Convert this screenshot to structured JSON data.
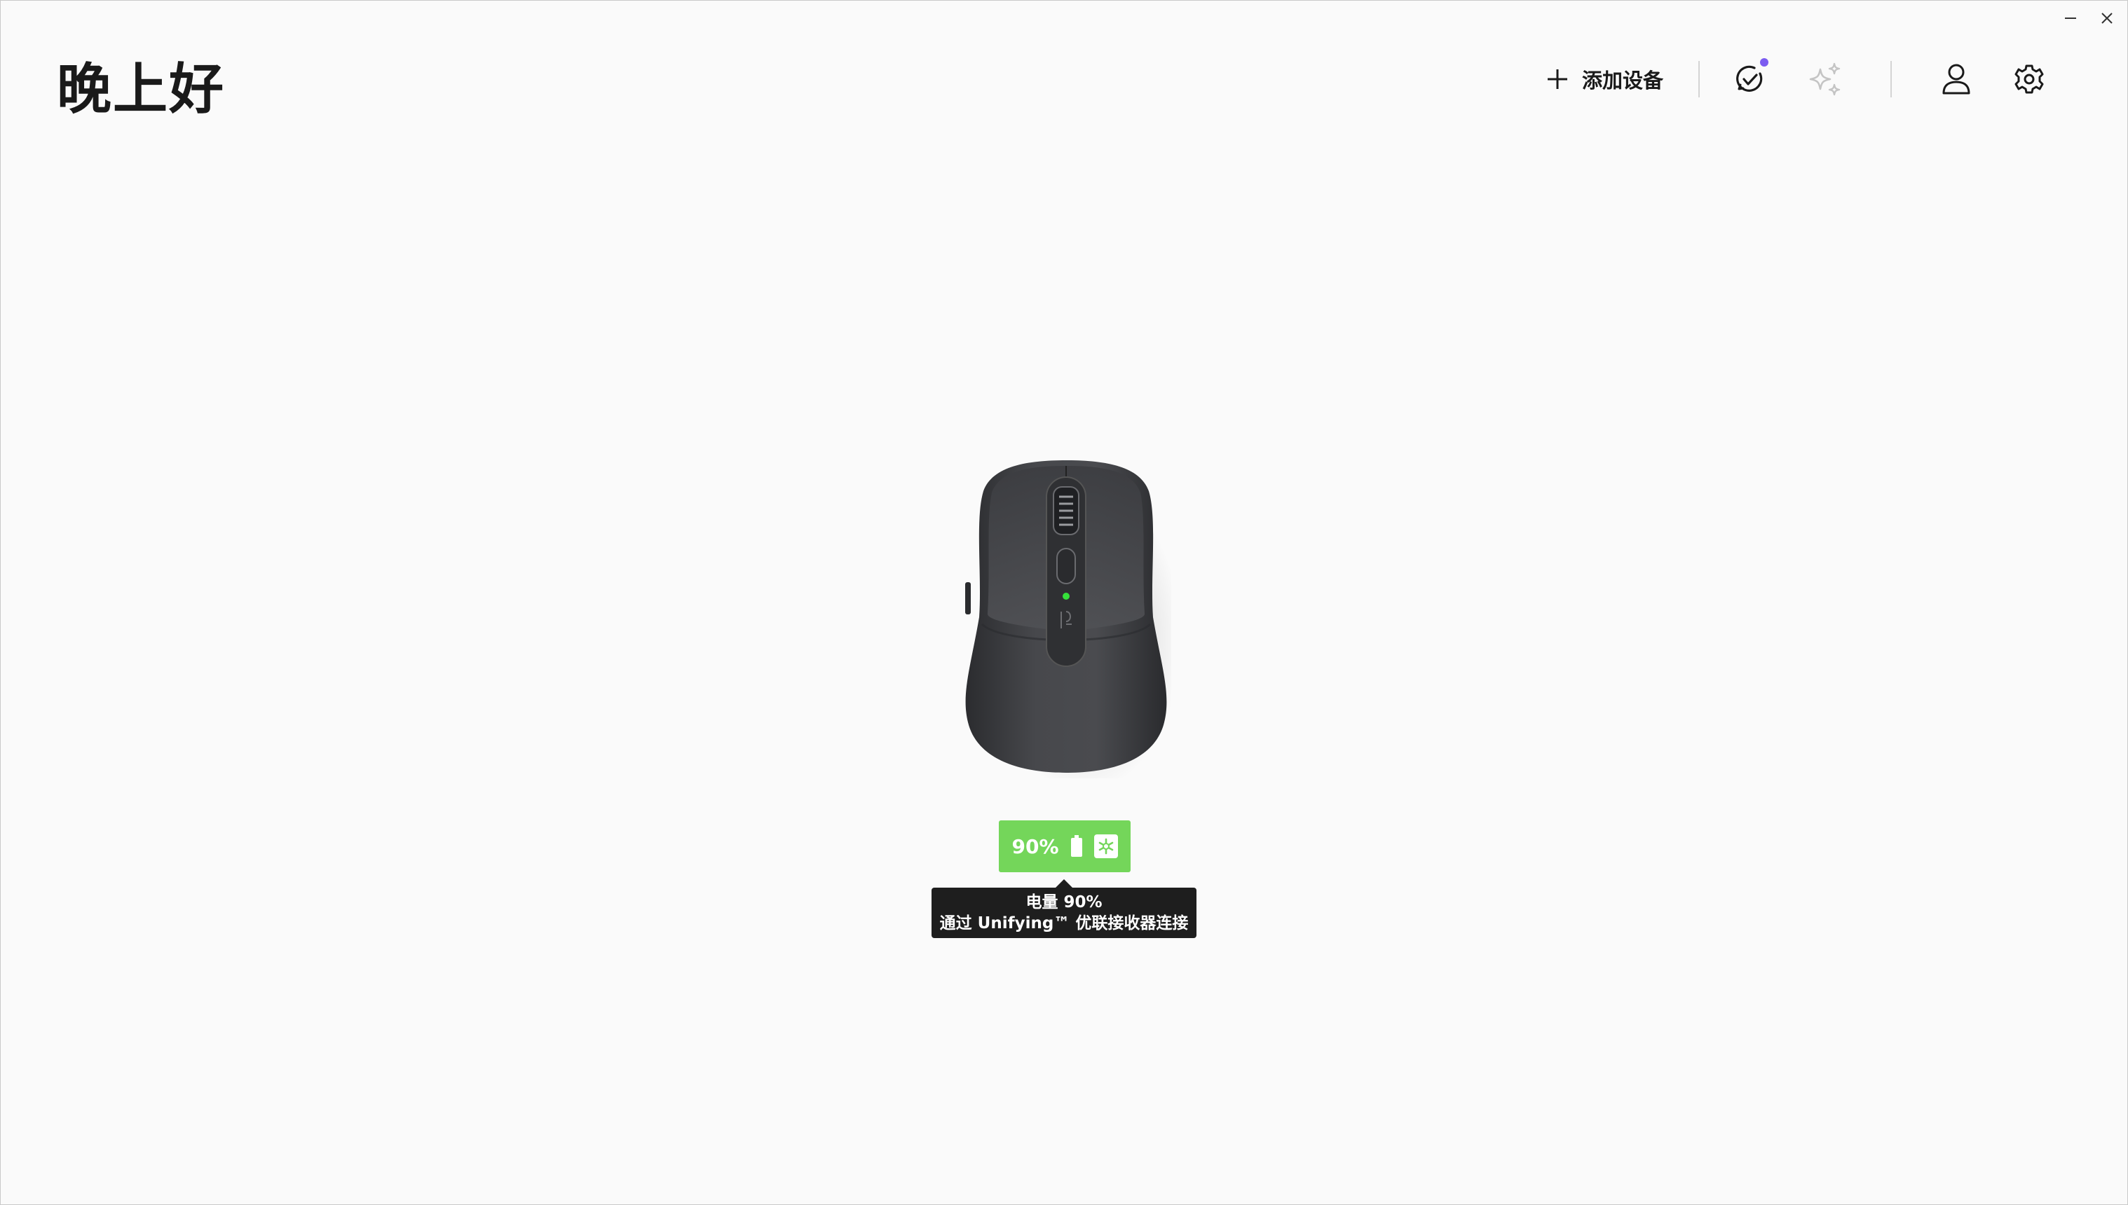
{
  "window": {
    "minimize_label": "—",
    "close_label": "✕"
  },
  "greeting": "晚上好",
  "toolbar": {
    "add_device_label": "添加设备",
    "icons": {
      "add": "plus-icon",
      "updates": "check-update-icon",
      "smart_actions": "sparkle-icon",
      "account": "user-icon",
      "settings": "gear-icon"
    },
    "update_dot_color": "#7b5cf0"
  },
  "device": {
    "type": "mouse",
    "battery_percent": 90,
    "battery_label": "90%",
    "badge_color": "#74d65a",
    "connection_icon": "unifying-receiver-icon",
    "tooltip": {
      "line1": "电量 90%",
      "line2": "通过 Unifying™ 优联接收器连接"
    }
  }
}
